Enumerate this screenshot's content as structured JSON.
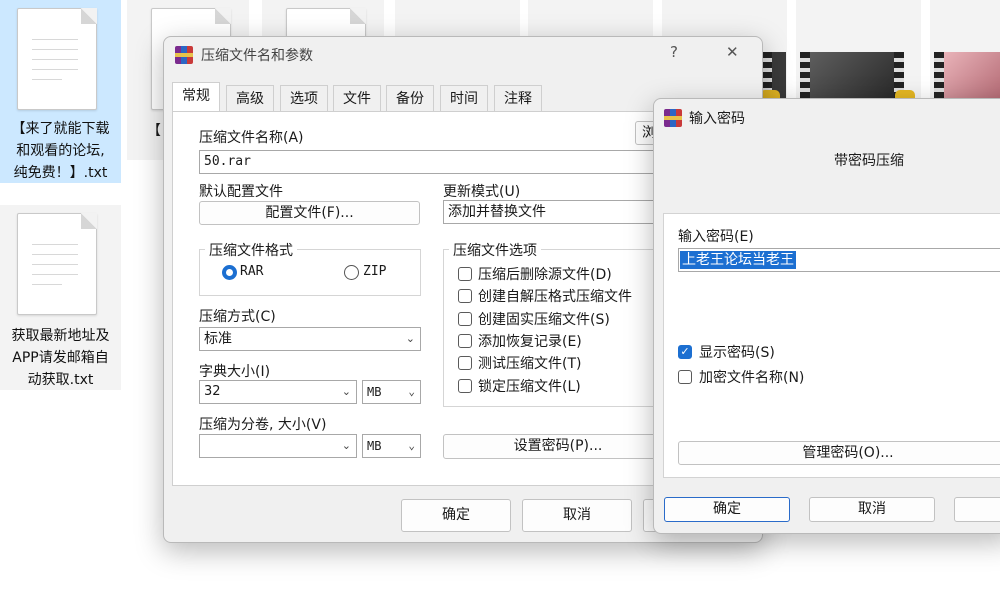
{
  "desktop": {
    "files": [
      {
        "label_lines": [
          "【来了就能下载",
          "和观看的论坛,",
          "纯免费！】.txt"
        ]
      },
      {
        "label_lines": [
          "获取最新地址及",
          "APP请发邮箱自",
          "动获取.txt"
        ]
      }
    ],
    "partial_label": "【"
  },
  "archive_dialog": {
    "title": "压缩文件名和参数",
    "help_icon": "?",
    "close_icon": "✕",
    "tabs": [
      "常规",
      "高级",
      "选项",
      "文件",
      "备份",
      "时间",
      "注释"
    ],
    "archive_name_label": "压缩文件名称(A)",
    "archive_name_value": "50.rar",
    "browse_label": "浏",
    "profile_label": "默认配置文件",
    "profile_button": "配置文件(F)...",
    "update_mode_label": "更新模式(U)",
    "update_mode_value": "添加并替换文件",
    "format_group": "压缩文件格式",
    "format_rar": "RAR",
    "format_zip": "ZIP",
    "method_label": "压缩方式(C)",
    "method_value": "标准",
    "dict_label": "字典大小(I)",
    "dict_value": "32",
    "dict_unit": "MB",
    "split_label": "压缩为分卷, 大小(V)",
    "split_value": "",
    "split_unit": "MB",
    "options_group": "压缩文件选项",
    "options": [
      "压缩后删除源文件(D)",
      "创建自解压格式压缩文件",
      "创建固实压缩文件(S)",
      "添加恢复记录(E)",
      "测试压缩文件(T)",
      "锁定压缩文件(L)"
    ],
    "set_password_button": "设置密码(P)...",
    "ok_button": "确定",
    "cancel_button": "取消"
  },
  "password_dialog": {
    "title": "输入密码",
    "heading": "带密码压缩",
    "password_label": "输入密码(E)",
    "password_value": "上老王论坛当老王",
    "show_password_label": "显示密码(S)",
    "show_password_checked": true,
    "encrypt_names_label": "加密文件名称(N)",
    "encrypt_names_checked": false,
    "manage_button": "管理密码(O)...",
    "ok_button": "确定",
    "cancel_button": "取消"
  },
  "colors": {
    "accent": "#1c6fd1",
    "selection": "#cce8ff"
  }
}
